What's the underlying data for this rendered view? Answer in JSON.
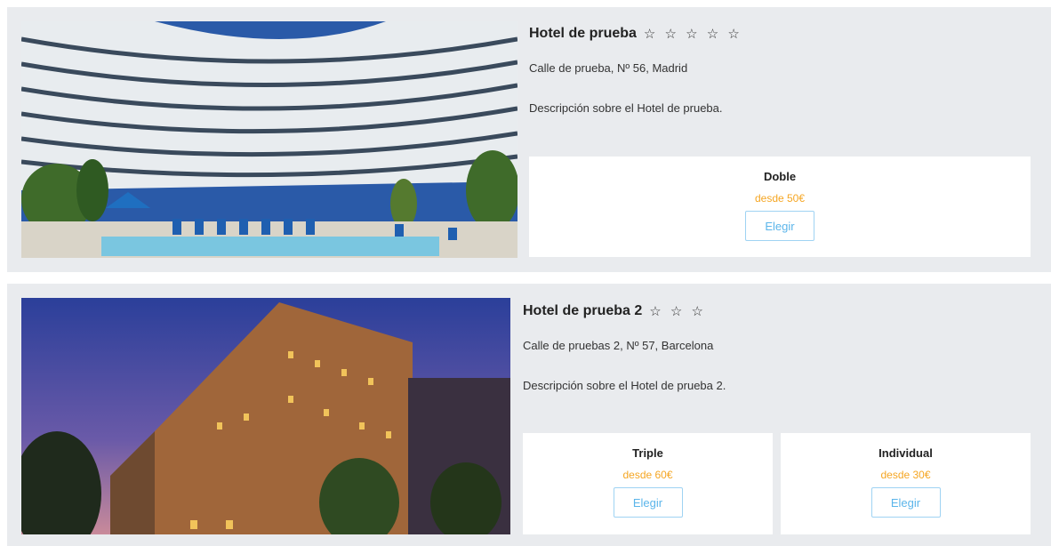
{
  "hotels": [
    {
      "name": "Hotel de prueba",
      "stars": "☆ ☆ ☆ ☆ ☆",
      "address": "Calle de prueba, Nº 56, Madrid",
      "description": "Descripción sobre el Hotel de prueba.",
      "rooms": [
        {
          "name": "Doble",
          "price": "desde 50€",
          "button": "Elegir"
        }
      ]
    },
    {
      "name": "Hotel de prueba 2",
      "stars": "☆ ☆ ☆",
      "address": "Calle de pruebas 2, Nº 57, Barcelona",
      "description": "Descripción sobre el Hotel de prueba 2.",
      "rooms": [
        {
          "name": "Triple",
          "price": "desde 60€",
          "button": "Elegir"
        },
        {
          "name": "Individual",
          "price": "desde 30€",
          "button": "Elegir"
        }
      ]
    }
  ],
  "colors": {
    "price": "#f5a623",
    "button_text": "#5bb5ea",
    "card_bg": "#e9ebee"
  }
}
